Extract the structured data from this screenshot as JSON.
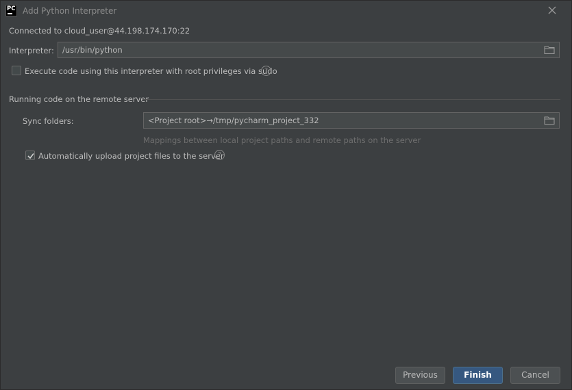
{
  "window": {
    "title": "Add Python Interpreter",
    "app_logo_text": "PC"
  },
  "connection": {
    "text": "Connected to cloud_user@44.198.174.170:22"
  },
  "interpreter": {
    "label": "Interpreter:",
    "value": "/usr/bin/python"
  },
  "sudo": {
    "label": "Execute code using this interpreter with root privileges via sudo",
    "checked": false
  },
  "remote_section": {
    "title": "Running code on the remote server",
    "sync_label": "Sync folders:",
    "sync_value": "<Project root>→/tmp/pycharm_project_332",
    "sync_hint": "Mappings between local project paths and remote paths on the server",
    "auto_upload_label": "Automatically upload project files to the server",
    "auto_upload_checked": true
  },
  "buttons": {
    "previous": "Previous",
    "finish": "Finish",
    "cancel": "Cancel"
  },
  "help_glyph": "?",
  "colors": {
    "background": "#3c3f41",
    "primary_button": "#365880",
    "field_bg": "#45494a"
  }
}
